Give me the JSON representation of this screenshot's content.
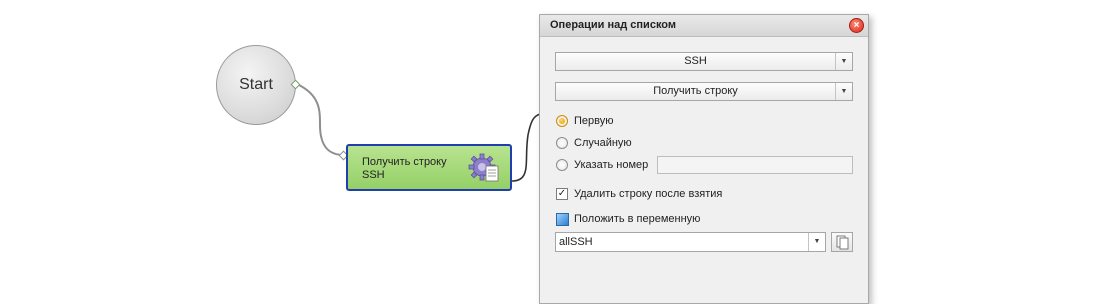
{
  "canvas": {
    "start_label": "Start",
    "action_label": "Получить строку\nSSH"
  },
  "dialog": {
    "title": "Операции над списком",
    "close_glyph": "×",
    "list_combo": {
      "value": "SSH"
    },
    "operation_combo": {
      "value": "Получить строку"
    },
    "options": [
      {
        "label": "Первую",
        "checked": true
      },
      {
        "label": "Случайную",
        "checked": false
      },
      {
        "label": "Указать номер",
        "checked": false
      }
    ],
    "number_input": {
      "value": ""
    },
    "delete_after": {
      "label": "Удалить строку после взятия",
      "checked": true,
      "glyph": "✓"
    },
    "save_to_variable": {
      "label": "Положить в переменную"
    },
    "variable_combo": {
      "value": "allSSH"
    }
  },
  "colors": {
    "node_green": "#a5d97a",
    "node_border": "#1f3fae",
    "radio_selected": "#e59a00",
    "close_red": "#d8281a"
  },
  "icons": {
    "gear": "gear-document-icon",
    "paste": "clipboard-icon"
  }
}
